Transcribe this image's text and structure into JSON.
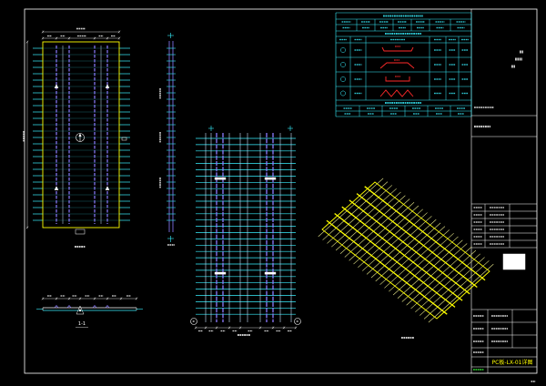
{
  "title_block": {
    "title": "PC板-LX-01详图"
  },
  "section_1_1": {
    "label": "1-1"
  },
  "colors": {
    "background": "#000000",
    "frame": "#ffffff",
    "cyan": "#38f0ff",
    "yellow": "#ffff00",
    "purple": "#8c7cff",
    "red": "#ff2a2a",
    "light_blue": "#c8e4ff",
    "iso_bar": "#e6e68a",
    "green": "#3cff3c"
  }
}
